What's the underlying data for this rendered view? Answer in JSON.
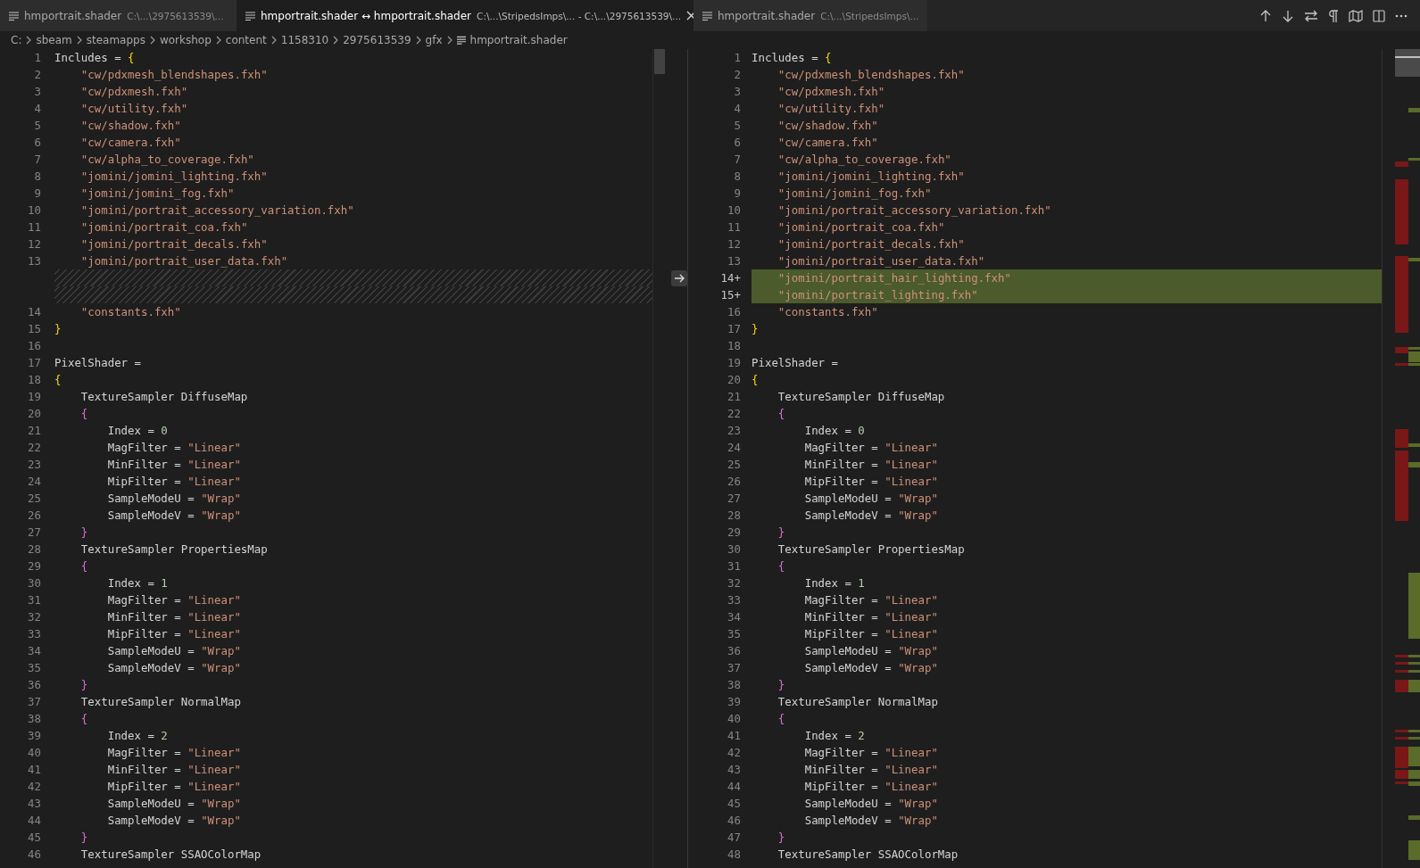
{
  "tabs": [
    {
      "title": "hmportrait.shader",
      "description": "C:\\...\\2975613539\\...",
      "selected": false
    },
    {
      "title": "hmportrait.shader ↔ hmportrait.shader",
      "description": "C:\\...\\StripedsImps\\... - C:\\...\\2975613539\\...",
      "selected": true
    },
    {
      "title": "hmportrait.shader",
      "description": "C:\\...\\StripedsImps\\...",
      "selected": false
    }
  ],
  "breadcrumb": [
    "C:",
    "sbeam",
    "steamapps",
    "workshop",
    "content",
    "1158310",
    "2975613539",
    "gfx",
    "hmportrait.shader"
  ],
  "left_pane": [
    {
      "n": "1",
      "text": "Includes = {",
      "kind": "normal"
    },
    {
      "n": "2",
      "text": "    \"cw/pdxmesh_blendshapes.fxh\"",
      "kind": "normal"
    },
    {
      "n": "3",
      "text": "    \"cw/pdxmesh.fxh\"",
      "kind": "normal"
    },
    {
      "n": "4",
      "text": "    \"cw/utility.fxh\"",
      "kind": "normal"
    },
    {
      "n": "5",
      "text": "    \"cw/shadow.fxh\"",
      "kind": "normal"
    },
    {
      "n": "6",
      "text": "    \"cw/camera.fxh\"",
      "kind": "normal"
    },
    {
      "n": "7",
      "text": "    \"cw/alpha_to_coverage.fxh\"",
      "kind": "normal"
    },
    {
      "n": "8",
      "text": "    \"jomini/jomini_lighting.fxh\"",
      "kind": "normal"
    },
    {
      "n": "9",
      "text": "    \"jomini/jomini_fog.fxh\"",
      "kind": "normal"
    },
    {
      "n": "10",
      "text": "    \"jomini/portrait_accessory_variation.fxh\"",
      "kind": "normal"
    },
    {
      "n": "11",
      "text": "    \"jomini/portrait_coa.fxh\"",
      "kind": "normal"
    },
    {
      "n": "12",
      "text": "    \"jomini/portrait_decals.fxh\"",
      "kind": "normal"
    },
    {
      "n": "13",
      "text": "    \"jomini/portrait_user_data.fxh\"",
      "kind": "normal"
    },
    {
      "kind": "filler"
    },
    {
      "kind": "filler"
    },
    {
      "n": "14",
      "text": "    \"constants.fxh\"",
      "kind": "normal"
    },
    {
      "n": "15",
      "text": "}",
      "kind": "normal"
    },
    {
      "n": "16",
      "kind": "normal"
    },
    {
      "n": "17",
      "text": "PixelShader =",
      "kind": "normal"
    },
    {
      "n": "18",
      "text": "{",
      "kind": "normal"
    },
    {
      "n": "19",
      "text": "    TextureSampler DiffuseMap",
      "kind": "normal"
    },
    {
      "n": "20",
      "text": "    {",
      "kind": "normal"
    },
    {
      "n": "21",
      "text": "        Index = 0",
      "kind": "normal"
    },
    {
      "n": "22",
      "text": "        MagFilter = \"Linear\"",
      "kind": "normal"
    },
    {
      "n": "23",
      "text": "        MinFilter = \"Linear\"",
      "kind": "normal"
    },
    {
      "n": "24",
      "text": "        MipFilter = \"Linear\"",
      "kind": "normal"
    },
    {
      "n": "25",
      "text": "        SampleModeU = \"Wrap\"",
      "kind": "normal"
    },
    {
      "n": "26",
      "text": "        SampleModeV = \"Wrap\"",
      "kind": "normal"
    },
    {
      "n": "27",
      "text": "    }",
      "kind": "normal"
    },
    {
      "n": "28",
      "text": "    TextureSampler PropertiesMap",
      "kind": "normal"
    },
    {
      "n": "29",
      "text": "    {",
      "kind": "normal"
    },
    {
      "n": "30",
      "text": "        Index = 1",
      "kind": "normal"
    },
    {
      "n": "31",
      "text": "        MagFilter = \"Linear\"",
      "kind": "normal"
    },
    {
      "n": "32",
      "text": "        MinFilter = \"Linear\"",
      "kind": "normal"
    },
    {
      "n": "33",
      "text": "        MipFilter = \"Linear\"",
      "kind": "normal"
    },
    {
      "n": "34",
      "text": "        SampleModeU = \"Wrap\"",
      "kind": "normal"
    },
    {
      "n": "35",
      "text": "        SampleModeV = \"Wrap\"",
      "kind": "normal"
    },
    {
      "n": "36",
      "text": "    }",
      "kind": "normal"
    },
    {
      "n": "37",
      "text": "    TextureSampler NormalMap",
      "kind": "normal"
    },
    {
      "n": "38",
      "text": "    {",
      "kind": "normal"
    },
    {
      "n": "39",
      "text": "        Index = 2",
      "kind": "normal"
    },
    {
      "n": "40",
      "text": "        MagFilter = \"Linear\"",
      "kind": "normal"
    },
    {
      "n": "41",
      "text": "        MinFilter = \"Linear\"",
      "kind": "normal"
    },
    {
      "n": "42",
      "text": "        MipFilter = \"Linear\"",
      "kind": "normal"
    },
    {
      "n": "43",
      "text": "        SampleModeU = \"Wrap\"",
      "kind": "normal"
    },
    {
      "n": "44",
      "text": "        SampleModeV = \"Wrap\"",
      "kind": "normal"
    },
    {
      "n": "45",
      "text": "    }",
      "kind": "normal"
    },
    {
      "n": "46",
      "text": "    TextureSampler SSAOColorMap",
      "kind": "normal"
    }
  ],
  "right_pane": [
    {
      "n": "1",
      "text": "Includes = {",
      "kind": "normal"
    },
    {
      "n": "2",
      "text": "    \"cw/pdxmesh_blendshapes.fxh\"",
      "kind": "normal"
    },
    {
      "n": "3",
      "text": "    \"cw/pdxmesh.fxh\"",
      "kind": "normal"
    },
    {
      "n": "4",
      "text": "    \"cw/utility.fxh\"",
      "kind": "normal"
    },
    {
      "n": "5",
      "text": "    \"cw/shadow.fxh\"",
      "kind": "normal"
    },
    {
      "n": "6",
      "text": "    \"cw/camera.fxh\"",
      "kind": "normal"
    },
    {
      "n": "7",
      "text": "    \"cw/alpha_to_coverage.fxh\"",
      "kind": "normal"
    },
    {
      "n": "8",
      "text": "    \"jomini/jomini_lighting.fxh\"",
      "kind": "normal"
    },
    {
      "n": "9",
      "text": "    \"jomini/jomini_fog.fxh\"",
      "kind": "normal"
    },
    {
      "n": "10",
      "text": "    \"jomini/portrait_accessory_variation.fxh\"",
      "kind": "normal"
    },
    {
      "n": "11",
      "text": "    \"jomini/portrait_coa.fxh\"",
      "kind": "normal"
    },
    {
      "n": "12",
      "text": "    \"jomini/portrait_decals.fxh\"",
      "kind": "normal"
    },
    {
      "n": "13",
      "text": "    \"jomini/portrait_user_data.fxh\"",
      "kind": "normal"
    },
    {
      "n": "14+",
      "text": "    \"jomini/portrait_hair_lighting.fxh\"",
      "kind": "added"
    },
    {
      "n": "15+",
      "text": "    \"jomini/portrait_lighting.fxh\"",
      "kind": "added"
    },
    {
      "n": "16",
      "text": "    \"constants.fxh\"",
      "kind": "normal"
    },
    {
      "n": "17",
      "text": "}",
      "kind": "normal"
    },
    {
      "n": "18",
      "kind": "normal"
    },
    {
      "n": "19",
      "text": "PixelShader =",
      "kind": "normal"
    },
    {
      "n": "20",
      "text": "{",
      "kind": "normal"
    },
    {
      "n": "21",
      "text": "    TextureSampler DiffuseMap",
      "kind": "normal"
    },
    {
      "n": "22",
      "text": "    {",
      "kind": "normal"
    },
    {
      "n": "23",
      "text": "        Index = 0",
      "kind": "normal"
    },
    {
      "n": "24",
      "text": "        MagFilter = \"Linear\"",
      "kind": "normal"
    },
    {
      "n": "25",
      "text": "        MinFilter = \"Linear\"",
      "kind": "normal"
    },
    {
      "n": "26",
      "text": "        MipFilter = \"Linear\"",
      "kind": "normal"
    },
    {
      "n": "27",
      "text": "        SampleModeU = \"Wrap\"",
      "kind": "normal"
    },
    {
      "n": "28",
      "text": "        SampleModeV = \"Wrap\"",
      "kind": "normal"
    },
    {
      "n": "29",
      "text": "    }",
      "kind": "normal"
    },
    {
      "n": "30",
      "text": "    TextureSampler PropertiesMap",
      "kind": "normal"
    },
    {
      "n": "31",
      "text": "    {",
      "kind": "normal"
    },
    {
      "n": "32",
      "text": "        Index = 1",
      "kind": "normal"
    },
    {
      "n": "33",
      "text": "        MagFilter = \"Linear\"",
      "kind": "normal"
    },
    {
      "n": "34",
      "text": "        MinFilter = \"Linear\"",
      "kind": "normal"
    },
    {
      "n": "35",
      "text": "        MipFilter = \"Linear\"",
      "kind": "normal"
    },
    {
      "n": "36",
      "text": "        SampleModeU = \"Wrap\"",
      "kind": "normal"
    },
    {
      "n": "37",
      "text": "        SampleModeV = \"Wrap\"",
      "kind": "normal"
    },
    {
      "n": "38",
      "text": "    }",
      "kind": "normal"
    },
    {
      "n": "39",
      "text": "    TextureSampler NormalMap",
      "kind": "normal"
    },
    {
      "n": "40",
      "text": "    {",
      "kind": "normal"
    },
    {
      "n": "41",
      "text": "        Index = 2",
      "kind": "normal"
    },
    {
      "n": "42",
      "text": "        MagFilter = \"Linear\"",
      "kind": "normal"
    },
    {
      "n": "43",
      "text": "        MinFilter = \"Linear\"",
      "kind": "normal"
    },
    {
      "n": "44",
      "text": "        MipFilter = \"Linear\"",
      "kind": "normal"
    },
    {
      "n": "45",
      "text": "        SampleModeU = \"Wrap\"",
      "kind": "normal"
    },
    {
      "n": "46",
      "text": "        SampleModeV = \"Wrap\"",
      "kind": "normal"
    },
    {
      "n": "47",
      "text": "    }",
      "kind": "normal"
    },
    {
      "n": "48",
      "text": "    TextureSampler SSAOColorMap",
      "kind": "normal"
    }
  ]
}
